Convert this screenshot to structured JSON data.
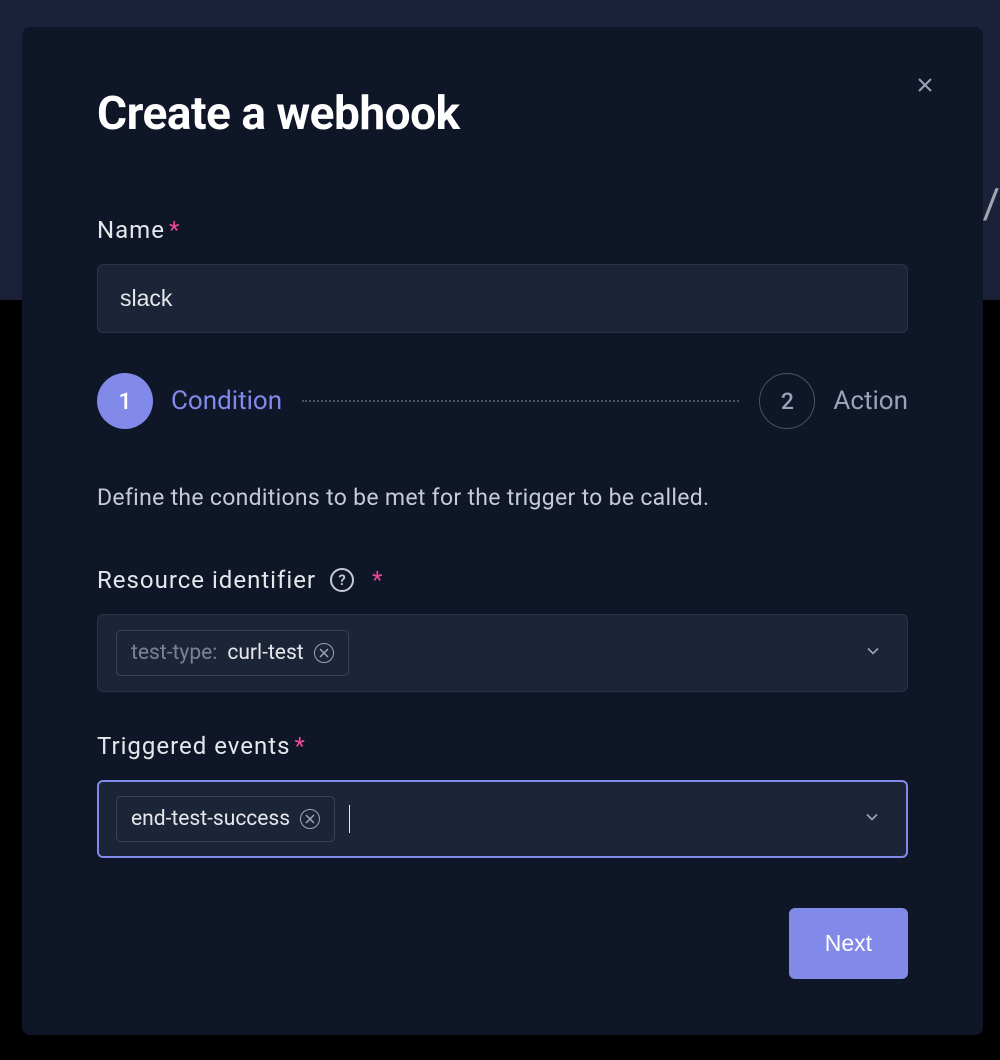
{
  "modal": {
    "title": "Create a webhook",
    "fields": {
      "name": {
        "label": "Name",
        "value": "slack"
      },
      "resource_identifier": {
        "label": "Resource identifier",
        "tag": {
          "key": "test-type:",
          "value": "curl-test"
        }
      },
      "triggered_events": {
        "label": "Triggered events",
        "tag": {
          "value": "end-test-success"
        }
      }
    },
    "stepper": {
      "step1": {
        "number": "1",
        "label": "Condition"
      },
      "step2": {
        "number": "2",
        "label": "Action"
      }
    },
    "description": "Define the conditions to be met for the trigger to be called.",
    "next_button": "Next"
  }
}
